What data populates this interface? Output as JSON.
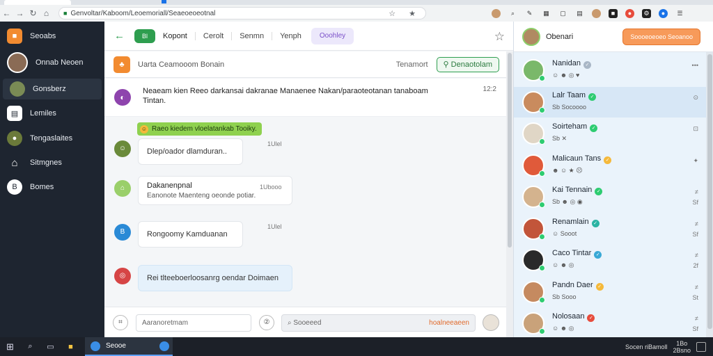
{
  "browser": {
    "url": "Genvoltar/Kaboom/Leoemoriall/Seaeoeoeotnal",
    "nav_back": "←",
    "nav_forward": "→",
    "nav_reload": "↻",
    "nav_home": "⌂",
    "omnibox_right": "☆ ★"
  },
  "sidebar": {
    "items": [
      {
        "label": "Seoabs",
        "icon": "square-app-icon",
        "glyph": "■",
        "color": "#f28b30"
      },
      {
        "label": "Onnab Neoen",
        "icon": "user-avatar",
        "glyph": "",
        "color": "#8a6b55"
      },
      {
        "label": "Gonsberz",
        "icon": "contact-avatar",
        "glyph": "",
        "color": "#7a8b55"
      },
      {
        "label": "Lemiles",
        "icon": "document-icon",
        "glyph": "▤",
        "color": "#3b4656"
      },
      {
        "label": "Tengaslaites",
        "icon": "person-icon",
        "glyph": "●",
        "color": "#6b7a3a"
      },
      {
        "label": "Sitmgnes",
        "icon": "shirt-icon",
        "glyph": "⌂",
        "color": "#3b4656"
      },
      {
        "label": "Bomes",
        "icon": "circle-b-icon",
        "glyph": "B",
        "color": "#ffffff"
      }
    ]
  },
  "main": {
    "topbar": {
      "green_pill": "Bl",
      "title": "Kopont",
      "links": [
        "Cerolt",
        "Senmn",
        "Yenph"
      ],
      "purple_tab": "Ooohley"
    },
    "chat_header": {
      "name": "Uarta Ceamooom Bonain",
      "status": "Tenamort",
      "button": "Denaotolam"
    },
    "pinned": {
      "text": "Neaeam kien Reeo darkansai dakranae Manaenee Nakan/paraoteotanan tanaboam Tintan.",
      "time": "12:2"
    },
    "system_pill": "Raeo kiedem vloelatankab Tooiky.",
    "messages": [
      {
        "line1": "Dlep/oador dlamduran..",
        "line2": "",
        "time": "1Ulel",
        "avatar_glyph": "☺",
        "avatar_color": "#6a8a3a",
        "bubble": "white"
      },
      {
        "line1": "Dakanenpnal",
        "line2": "Eanonote Maenteng oeonde potiar.",
        "time": "1Ubooo",
        "avatar_glyph": "⌂",
        "avatar_color": "#9acf6a",
        "bubble": "white"
      },
      {
        "line1": "Rongoomy Kamduanan",
        "line2": "",
        "time": "1Ulel",
        "avatar_glyph": "B",
        "avatar_color": "#2a8ad6",
        "bubble": "white"
      },
      {
        "line1": "Rei tlteeboerloosanrg oendar Doimaen",
        "line2": "",
        "time": "",
        "avatar_glyph": "◎",
        "avatar_color": "#d64545",
        "bubble": "blue"
      }
    ],
    "composer": {
      "attach_glyph": "⌗",
      "input_placeholder": "Aaranoretmam",
      "mid_glyph": "②",
      "search_placeholder": "Sooeeed",
      "search_hint": "hoalneeaeen"
    }
  },
  "contacts": {
    "header_name": "Obenari",
    "header_button": "Soooeoeoeo Seoanoo",
    "list": [
      {
        "name": "Nanidan",
        "sub": "☺ ☻ ◎ ♥",
        "meta1": "•••",
        "meta2": "",
        "badge": "#a9b7c6",
        "avatar": "#7ab86a",
        "selected": false
      },
      {
        "name": "Lalr Taam",
        "sub": "Sb Socoooo",
        "meta1": "⊙",
        "meta2": "",
        "badge": "#2ecc71",
        "avatar": "#c98b5e",
        "selected": true
      },
      {
        "name": "Soirteham",
        "sub": "Sb ✕",
        "meta1": "⊡",
        "meta2": "",
        "badge": "#2ecc71",
        "avatar": "#e0d6c6",
        "selected": false
      },
      {
        "name": "Malicaun Tans",
        "sub": "☻ ☺ ★ ☹",
        "meta1": "✦",
        "meta2": "",
        "badge": "#f5b93b",
        "avatar": "#e05a3a",
        "selected": false
      },
      {
        "name": "Kai Tennain",
        "sub": "Sb ☻ ◎ ◉",
        "meta1": "≠",
        "meta2": "Sf",
        "badge": "#2ecc71",
        "avatar": "#d4b38e",
        "selected": false
      },
      {
        "name": "Renamlain",
        "sub": "☺ Sooot",
        "meta1": "≠",
        "meta2": "Sf",
        "badge": "#2ab3a3",
        "avatar": "#c2553a",
        "selected": false
      },
      {
        "name": "Caco Tintar",
        "sub": "☺ ☻ ◎",
        "meta1": "≠",
        "meta2": "2f",
        "badge": "#3aa9d6",
        "avatar": "#2a2a2a",
        "selected": false
      },
      {
        "name": "Pandn Daer",
        "sub": "Sb Sooo",
        "meta1": "≠",
        "meta2": "St",
        "badge": "#f5b93b",
        "avatar": "#c58a60",
        "selected": false
      },
      {
        "name": "Nolosaan",
        "sub": "☺ ☻ ◎",
        "meta1": "≠",
        "meta2": "Sf",
        "badge": "#e74c3c",
        "avatar": "#c9a27a",
        "selected": false
      }
    ]
  },
  "taskbar": {
    "active_label": "Seooe",
    "tray_text": "Socen riBamoll",
    "clock_line1": "1Bo",
    "clock_line2": "2Bsno"
  },
  "colors": {
    "accent_green": "#2e9e4f",
    "accent_orange": "#f28b30",
    "accent_purple": "#7a4fc9",
    "sidebar_bg": "#1e2530"
  }
}
